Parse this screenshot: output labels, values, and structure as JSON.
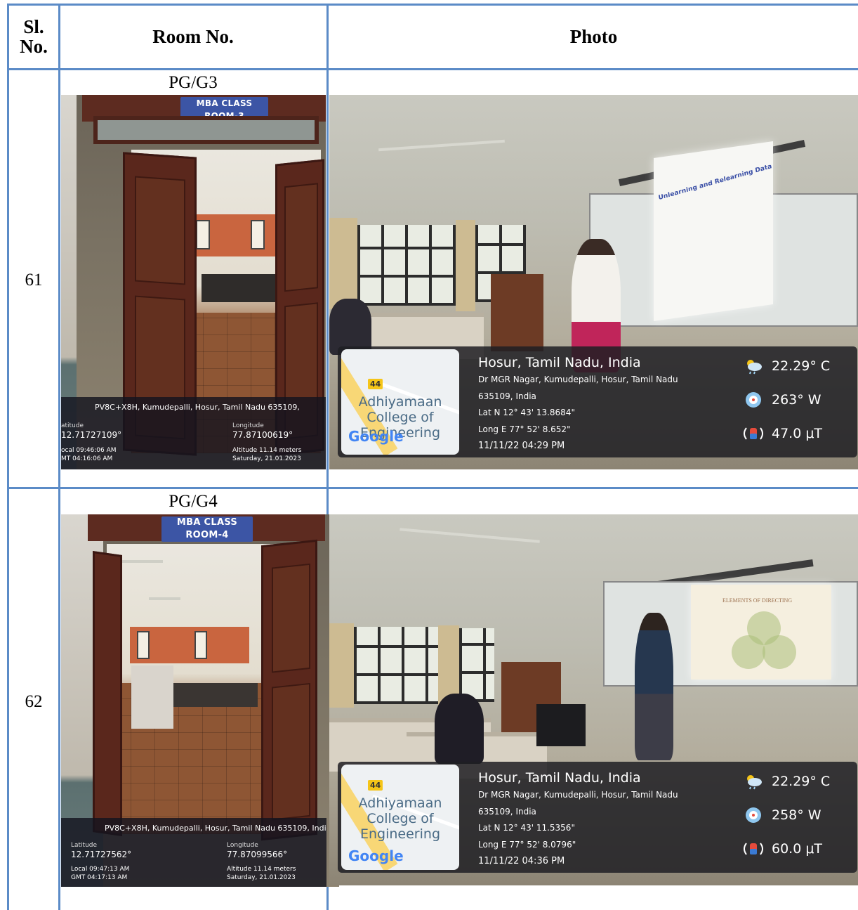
{
  "table": {
    "headers": {
      "sl_no": "Sl. No.",
      "room_no": "Room No.",
      "photo": "Photo"
    },
    "rows": [
      {
        "sl_no": "61",
        "room_no": "PG/G3",
        "door_photo": {
          "sign": "MBA CLASS ROOM-3",
          "address": "PV8C+X8H, Kumudepalli, Hosur, Tamil Nadu 635109,",
          "latitude_label": "atitude",
          "latitude": "12.71727109°",
          "longitude_label": "Longitude",
          "longitude": "77.87100619°",
          "local_time": "ocal 09:46:06 AM",
          "gmt_time": "MT 04:16:06 AM",
          "altitude": "Altitude 11.14 meters",
          "date": "Saturday, 21.01.2023"
        },
        "class_photo": {
          "slide_title": "Unlearning and Relearning Data",
          "map_badge": "44",
          "map_place": "Adhiyamaan College of Engineering",
          "map_logo": "Google",
          "location_title": "Hosur, Tamil Nadu, India",
          "address_line1": "Dr MGR Nagar, Kumudepalli, Hosur, Tamil Nadu",
          "address_line2": "635109, India",
          "lat": "Lat N 12° 43' 13.8684\"",
          "long": "Long E 77° 52' 8.652\"",
          "datetime": "11/11/22 04:29 PM",
          "temperature": "22.29° C",
          "direction": "263° W",
          "magnetic": "47.0 μT"
        }
      },
      {
        "sl_no": "62",
        "room_no": "PG/G4",
        "door_photo": {
          "sign": "MBA CLASS ROOM-4",
          "address": "PV8C+X8H, Kumudepalli, Hosur, Tamil Nadu 635109, Indi",
          "latitude_label": "Latitude",
          "latitude": "12.71727562°",
          "longitude_label": "Longitude",
          "longitude": "77.87099566°",
          "local_time": "Local 09:47:13 AM",
          "gmt_time": "GMT 04:17:13 AM",
          "altitude": "Altitude 11.14 meters",
          "date": "Saturday, 21.01.2023"
        },
        "class_photo": {
          "slide_title": "ELEMENTS OF DIRECTING",
          "map_badge": "44",
          "map_place": "Adhiyamaan College of Engineering",
          "map_logo": "Google",
          "location_title": "Hosur, Tamil Nadu, India",
          "address_line1": "Dr MGR Nagar, Kumudepalli, Hosur, Tamil Nadu",
          "address_line2": "635109, India",
          "lat": "Lat N 12° 43' 11.5356\"",
          "long": "Long E 77° 52' 8.0796\"",
          "datetime": "11/11/22 04:36 PM",
          "temperature": "22.29° C",
          "direction": "258° W",
          "magnetic": "60.0 μT"
        }
      }
    ]
  },
  "icons": {
    "weather": "weather-cloud-icon",
    "compass": "compass-icon",
    "magnet": "magnetic-field-icon"
  },
  "colors": {
    "grid": "#5b8bc7",
    "overlay": "#1e1e23",
    "map_road": "#f8d776"
  }
}
